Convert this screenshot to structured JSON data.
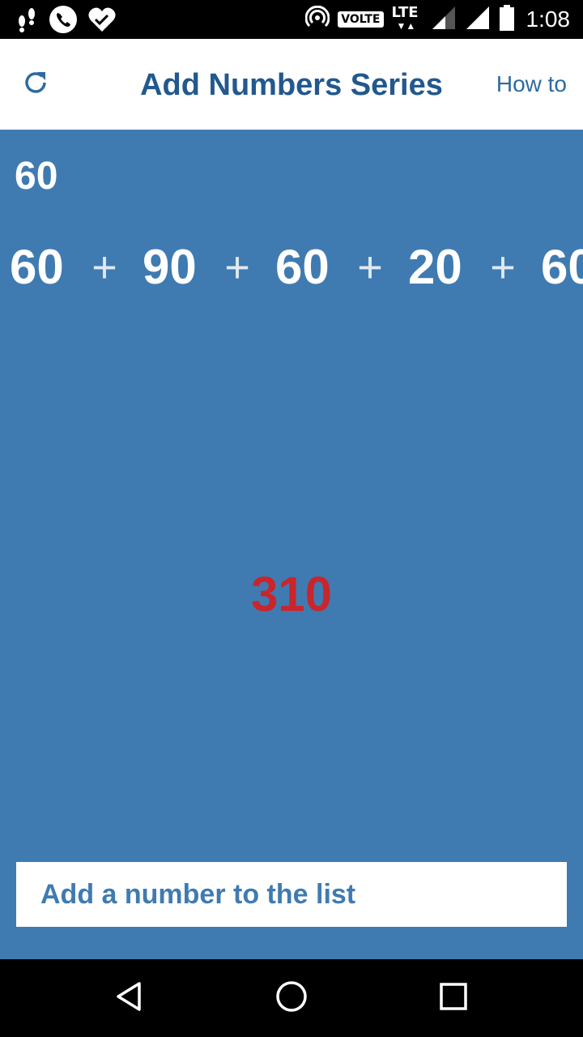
{
  "status_bar": {
    "volte": "VOLTE",
    "network": "LTE",
    "time": "1:08",
    "icons": [
      "footsteps-icon",
      "phone-icon",
      "heart-check-icon",
      "hotspot-icon",
      "signal-icon",
      "signal-full-icon",
      "battery-icon"
    ]
  },
  "app_bar": {
    "title": "Add Numbers Series",
    "how_to": "How to",
    "refresh_icon": "refresh-icon"
  },
  "main": {
    "current_number": "60",
    "series": {
      "n1": "60",
      "op1": "+",
      "n2": "90",
      "op2": "+",
      "n3": "60",
      "op3": "+",
      "n4": "20",
      "op4": "+",
      "n5": "60"
    },
    "total": "310",
    "input_placeholder": "Add a number to the list"
  },
  "nav_bar": {
    "icons": [
      "back-icon",
      "home-icon",
      "recents-icon"
    ]
  },
  "colors": {
    "background": "#3f7bb1",
    "title": "#22588e",
    "total": "#c8262d"
  }
}
